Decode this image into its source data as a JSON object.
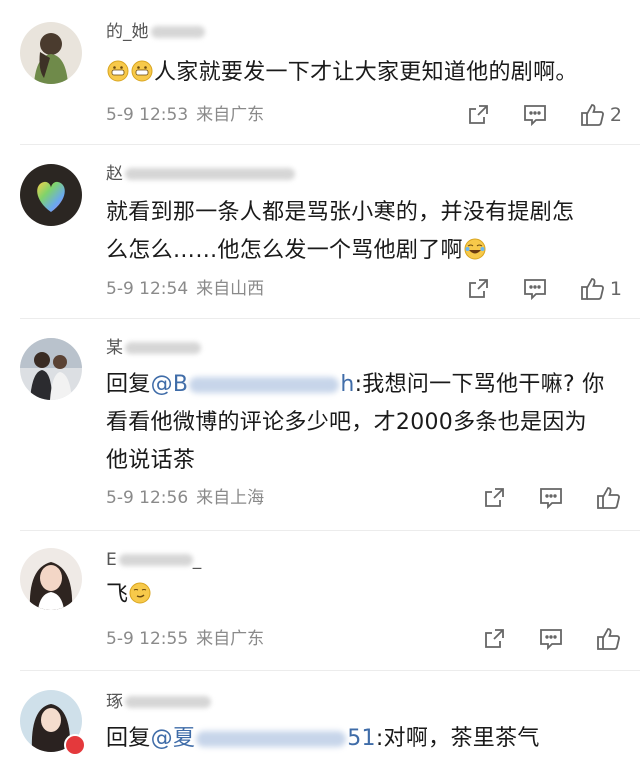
{
  "comments": [
    {
      "user": "的_她",
      "text": "人家就要发一下才让大家更知道他的剧啊。",
      "time": "5-9 12:53",
      "location": "来自广东",
      "likes": "2"
    },
    {
      "user": "赵",
      "text_line1": "就看到那一条人都是骂张小寒的，并没有提剧怎",
      "text_line2": "么怎么……他怎么发一个骂他剧了啊",
      "time": "5-9 12:54",
      "location": "来自山西",
      "likes": "1"
    },
    {
      "user": "某",
      "reply_prefix": "回复",
      "mention": "@B",
      "mention_end": "h",
      "text_line1": ":我想问一下骂他干嘛? 你",
      "text_line2": "看看他微博的评论多少吧，才2000多条也是因为",
      "text_line3": "他说话茶",
      "time": "5-9 12:56",
      "location": "来自上海"
    },
    {
      "user": "E",
      "user_end": "_",
      "text": "飞",
      "time": "5-9 12:55",
      "location": "来自广东"
    },
    {
      "user": "琢",
      "reply_prefix": "回复",
      "mention": "@夏",
      "mention_end": "51",
      "text": ":对啊，茶里茶气"
    }
  ],
  "icons": {
    "share": "share-icon",
    "comment": "comment-icon",
    "like": "thumbs-up-icon"
  },
  "colors": {
    "mention": "#3f6ca8",
    "meta": "#8a8a8a",
    "icon": "#666666"
  }
}
